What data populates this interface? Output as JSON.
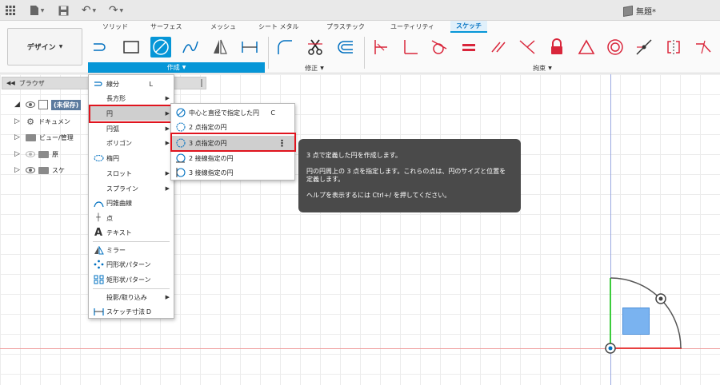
{
  "topbar": {
    "doc_title": "無題*"
  },
  "tabs": [
    "ソリッド",
    "サーフェス",
    "メッシュ",
    "シート メタル",
    "プラスチック",
    "ユーティリティ",
    "スケッチ"
  ],
  "active_tab": "スケッチ",
  "design_button": "デザイン",
  "groups": {
    "create": "作成",
    "modify": "修正",
    "constraints": "拘束"
  },
  "browser": {
    "title": "ブラウザ",
    "items": [
      {
        "label": "(未保存)"
      },
      {
        "label": "ドキュメン"
      },
      {
        "label": "ビュー/管理"
      },
      {
        "label": "原"
      },
      {
        "label": "スケ"
      }
    ]
  },
  "create_menu": {
    "items": [
      {
        "label": "線分",
        "shortcut": "L"
      },
      {
        "label": "長方形",
        "submenu": true
      },
      {
        "label": "円",
        "submenu": true
      },
      {
        "label": "円弧",
        "submenu": true
      },
      {
        "label": "ポリゴン",
        "submenu": true
      },
      {
        "label": "楕円"
      },
      {
        "label": "スロット",
        "submenu": true
      },
      {
        "label": "スプライン",
        "submenu": true
      },
      {
        "label": "円錐曲線"
      },
      {
        "label": "点"
      },
      {
        "label": "テキスト"
      },
      {
        "label": "ミラー"
      },
      {
        "label": "円形状パターン"
      },
      {
        "label": "矩形状パターン"
      },
      {
        "label": "投影/取り込み",
        "submenu": true
      },
      {
        "label": "スケッチ寸法",
        "shortcut": "D"
      }
    ]
  },
  "circle_submenu": {
    "items": [
      {
        "label": "中心と直径で指定した円",
        "shortcut": "C"
      },
      {
        "label": "2 点指定の円"
      },
      {
        "label": "3 点指定の円"
      },
      {
        "label": "2 接線指定の円"
      },
      {
        "label": "3 接線指定の円"
      }
    ]
  },
  "tooltip": {
    "title": "3 点で定義した円を作成します。",
    "body": "円の円周上の 3 点を指定します。これらの点は、円のサイズと位置を定義します。",
    "help": "ヘルプを表示するには Ctrl+/ を押してください。"
  },
  "colors": {
    "accent": "#0696d7",
    "highlight_box": "#e0141e",
    "constraint_red": "#d9263b",
    "tooltip_bg": "#4a4a4a"
  }
}
